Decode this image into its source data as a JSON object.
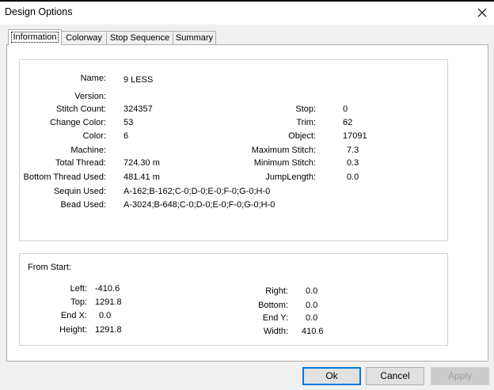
{
  "window": {
    "title": "Design Options"
  },
  "tabs": [
    {
      "label": "Information"
    },
    {
      "label": "Colorway"
    },
    {
      "label": "Stop Sequence"
    },
    {
      "label": "Summary"
    }
  ],
  "info": {
    "name": {
      "label": "Name:",
      "value": "9 LESS"
    },
    "version": {
      "label": "Version:",
      "value": ""
    },
    "stitch_count": {
      "label": "Stitch Count:",
      "value": "324357"
    },
    "change_color": {
      "label": "Change Color:",
      "value": "53"
    },
    "color": {
      "label": "Color:",
      "value": "6"
    },
    "machine": {
      "label": "Machine:",
      "value": ""
    },
    "total_thread": {
      "label": "Total Thread:",
      "value": "724.30 m"
    },
    "bottom_thread": {
      "label": "Bottom Thread Used:",
      "value": "481.41 m"
    },
    "sequin_used": {
      "label": "Sequin Used:",
      "value": "A-162;B-162;C-0;D-0;E-0;F-0;G-0;H-0"
    },
    "bead_used": {
      "label": "Bead Used:",
      "value": "A-3024;B-648;C-0;D-0;E-0;F-0;G-0;H-0"
    },
    "stop": {
      "label": "Stop:",
      "value": "0"
    },
    "trim": {
      "label": "Trim:",
      "value": "62"
    },
    "object": {
      "label": "Object:",
      "value": "17091"
    },
    "max_stitch": {
      "label": "Maximum Stitch:",
      "value": "7.3"
    },
    "min_stitch": {
      "label": "Minimum Stitch:",
      "value": "0.3"
    },
    "jump_length": {
      "label": "JumpLength:",
      "value": "0.0"
    }
  },
  "from_start": {
    "heading": "From Start:",
    "left": {
      "label": "Left:",
      "value": "-410.6"
    },
    "top": {
      "label": "Top:",
      "value": "1291.8"
    },
    "end_x": {
      "label": "End X:",
      "value": "0.0"
    },
    "height": {
      "label": "Height:",
      "value": "1291.8"
    },
    "right": {
      "label": "Right:",
      "value": "0.0"
    },
    "bottom": {
      "label": "Bottom:",
      "value": "0.0"
    },
    "end_y": {
      "label": "End Y:",
      "value": "0.0"
    },
    "width": {
      "label": "Width:",
      "value": "410.6"
    }
  },
  "buttons": {
    "ok": "Ok",
    "cancel": "Cancel",
    "apply": "Apply"
  }
}
